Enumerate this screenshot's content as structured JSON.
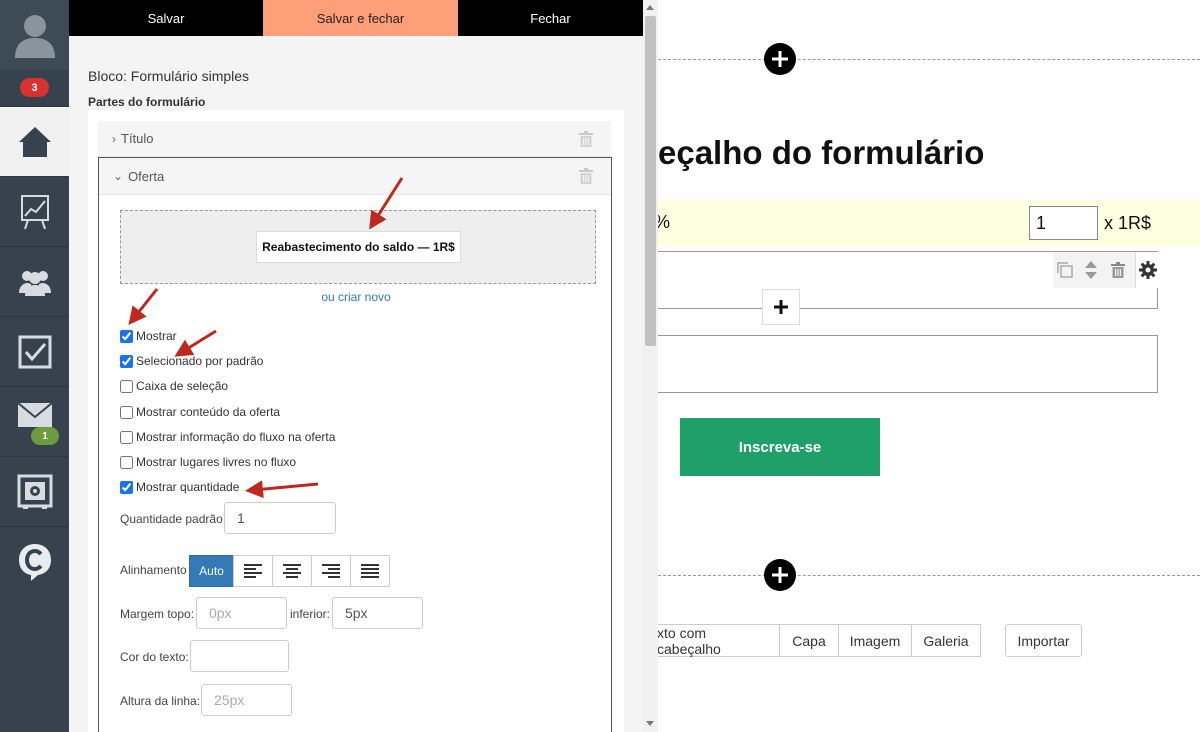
{
  "nav": {
    "notifications_badge": "3",
    "messages_badge": "1",
    "items": [
      "avatar-icon",
      "home-icon",
      "chart-icon",
      "users-icon",
      "checkbox-icon",
      "mail-icon",
      "safe-icon",
      "logo-c-icon"
    ]
  },
  "toolbar": {
    "save_label": "Salvar",
    "save_close_label": "Salvar e fechar",
    "close_label": "Fechar"
  },
  "editor": {
    "block_title": "Bloco: Formulário simples",
    "parts_label": "Partes do formulário",
    "parts": [
      {
        "label": "Título",
        "expanded": false
      },
      {
        "label": "Oferta",
        "expanded": true
      }
    ],
    "offer_chip": "Reabastecimento do saldo — 1R$",
    "create_new_link": "ou criar novo",
    "options": [
      {
        "label": "Mostrar",
        "checked": true
      },
      {
        "label": "Selecionado por padrão",
        "checked": true
      },
      {
        "label": "Caixa de seleção",
        "checked": false
      },
      {
        "label": "Mostrar conteúdo da oferta",
        "checked": false
      },
      {
        "label": "Mostrar informação do fluxo na oferta",
        "checked": false
      },
      {
        "label": "Mostrar lugares livres no fluxo",
        "checked": false
      },
      {
        "label": "Mostrar quantidade",
        "checked": true
      }
    ],
    "default_qty_label": "Quantidade padrão",
    "default_qty_value": "1",
    "alignment_label": "Alinhamento",
    "alignment_auto": "Auto",
    "margin_top_label": "Margem topo:",
    "margin_top_placeholder": "0px",
    "margin_bottom_label": "inferior:",
    "margin_bottom_value": "5px",
    "text_color_label": "Cor do texto:",
    "line_height_label": "Altura da linha:",
    "line_height_placeholder": "25px"
  },
  "canvas": {
    "heading": "eçalho do formulário",
    "qty_value": "1",
    "price_text": "x 1R$",
    "subscribe_label": "Inscreva-se",
    "block_tabs": [
      "xto com cabeçalho",
      "Capa",
      "Imagem",
      "Galeria"
    ],
    "import_label": "Importar"
  },
  "colors": {
    "save_close_bg": "#ff9f7a",
    "subscribe_bg": "#1fa06b",
    "annotation_arrow": "#c0281d",
    "nav_bg": "#36434f"
  }
}
